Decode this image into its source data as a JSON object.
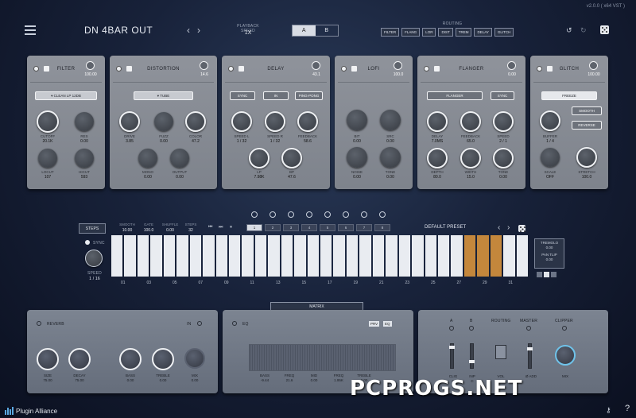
{
  "header": {
    "title": "DN 4BAR OUT",
    "playback_label": "PLAYBACK SPEED",
    "playback_value": "1X",
    "ab": [
      "A",
      "B"
    ],
    "routing_label": "ROUTING",
    "routing": [
      "FILTER",
      "FLANG",
      "LOR",
      "DIST",
      "TREM",
      "DELAY",
      "GLITCH"
    ],
    "version": "v2.0.0  ( x64  VST )"
  },
  "modules": {
    "filter": {
      "title": "FILTER",
      "mix": "100.00",
      "select": "CLEAN LP 12DB",
      "k1": "CUTOFF",
      "v1": "20.1K",
      "k2": "RES",
      "v2": "0.00",
      "k3": "LOCUT",
      "v3": "107",
      "k4": "HICUT",
      "v4": "593"
    },
    "distortion": {
      "title": "DISTORTION",
      "mix": "14.6",
      "select": "TUBE",
      "k1": "DRIVE",
      "v1": "3.85",
      "k2": "FUZZ",
      "v2": "0.00",
      "k3": "COLOR",
      "v3": "47.2",
      "k4": "MONO",
      "v4": "0.00",
      "k5": "OUTPUT",
      "v5": "0.00"
    },
    "delay": {
      "title": "DELAY",
      "mix": "43.1",
      "b1": "SYNC",
      "b2": "IN",
      "b3": "PING-PONG",
      "k1": "SPEED L",
      "v1": "1 / 32",
      "k2": "SPEED R",
      "v2": "1 / 32",
      "k3": "FEEDBACK",
      "v3": "58.6",
      "k4": "LP",
      "v4": "7.98K",
      "k5": "BP",
      "v5": "47.6"
    },
    "lofi": {
      "title": "LOFI",
      "mix": "100.0",
      "k1": "BIT",
      "v1": "0.00",
      "k2": "SRC",
      "v2": "0.00",
      "k3": "NOISE",
      "v3": "0.00",
      "k4": "TONE",
      "v4": "0.00"
    },
    "flanger": {
      "title": "FLANGER",
      "mix": "0.00",
      "b1": "FLANGER",
      "b2": "SYNC",
      "k1": "DELAY",
      "v1": "7.0MS",
      "k2": "FEEDBACK",
      "v2": "65.0",
      "k3": "SPEED",
      "v3": "2 / 1",
      "k4": "DEPTH",
      "v4": "80.0",
      "k5": "WIDTH",
      "v5": "15.0",
      "k6": "TONE",
      "v6": "0.00"
    },
    "glitch": {
      "title": "GLITCH",
      "mix": "100.00",
      "b1": "FREEZE",
      "b2": "SMOOTH",
      "b3": "REVERSE",
      "k1": "BUFFER",
      "v1": "1 / 4",
      "k2": "SCALE",
      "v2": "OFF",
      "k3": "STRETCH",
      "v3": "100.0"
    }
  },
  "seq": {
    "steps_btn": "STEPS",
    "params": [
      {
        "l": "SMOOTH",
        "v": "10.00"
      },
      {
        "l": "GATE",
        "v": "100.0"
      },
      {
        "l": "SHUFFLE",
        "v": "0.00"
      },
      {
        "l": "STEPS",
        "v": "32"
      }
    ],
    "snapshots": [
      "1",
      "2",
      "3",
      "4",
      "5",
      "6",
      "7",
      "8"
    ],
    "preset": "DEFAULT PRESET",
    "sync": "SYNC",
    "speed_l": "SPEED",
    "speed_v": "1 / 16",
    "tremolo": "TREMOLO",
    "trem_v": "0.00",
    "panlfo": "PAN TLIP",
    "pan_v": "0.00",
    "labels": [
      "01",
      "03",
      "05",
      "07",
      "09",
      "11",
      "13",
      "15",
      "17",
      "19",
      "21",
      "23",
      "25",
      "27",
      "29",
      "31"
    ],
    "active_steps": [
      27,
      28,
      29
    ]
  },
  "matrix": "MATRIX",
  "reverb": {
    "title": "REVERB",
    "in": "IN",
    "k1": "SIZE",
    "v1": "75.00",
    "k2": "DECAY",
    "v2": "75.00",
    "k3": "BASS",
    "v3": "0.00",
    "k4": "TREBLE",
    "v4": "0.00",
    "k5": "MIX",
    "v5": "0.00"
  },
  "eq": {
    "title": "EQ",
    "tags": [
      "PRV",
      "EQ"
    ],
    "k1": "BASS",
    "v1": "-9.44",
    "k2": "FREQ",
    "v2": "21.6",
    "k3": "MID",
    "v3": "0.00",
    "k4": "FREQ",
    "v4": "1.95K",
    "k5": "TREBLE",
    "v5": "0.00"
  },
  "master": {
    "a": "A",
    "b": "B",
    "routing": "ROUTING",
    "master": "MASTER",
    "clipper": "CLIPPER",
    "cv1": "C",
    "cv2": "C",
    "vol": "VOL",
    "pan": "PAN",
    "range": "Ø ADD",
    "mix": "MIX",
    "cl1": "CLIG",
    "cl2": "INP"
  },
  "footer": {
    "logo": "Plugin Alliance",
    "watermark": "PCPROGS.NET"
  }
}
